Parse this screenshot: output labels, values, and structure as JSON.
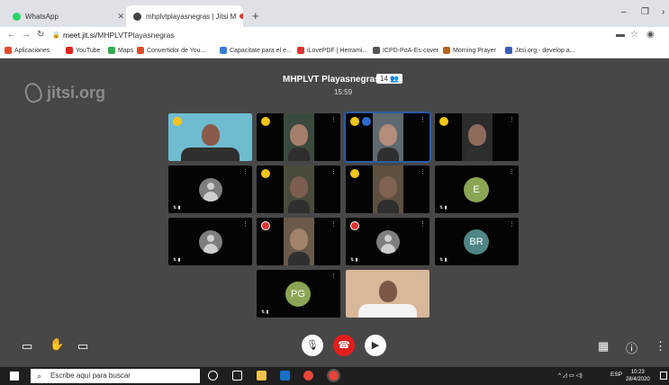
{
  "browser": {
    "tabs": [
      {
        "label": "WhatsApp",
        "color": "#25d366"
      },
      {
        "label": "mhplvtplayasnegras | Jitsi M",
        "color": "#444444"
      }
    ],
    "new_tab": "+",
    "url_prefix": "meet.jit.si/",
    "url_path": "MHPLVTPlayasnegras",
    "bookmarks": [
      {
        "label": "Aplicaciones",
        "color": "#e04c2d"
      },
      {
        "label": "YouTube",
        "color": "#e62117"
      },
      {
        "label": "Maps",
        "color": "#34a853"
      },
      {
        "label": "Convertidor de You...",
        "color": "#e04c2d"
      },
      {
        "label": "Capacítate para el e...",
        "color": "#3a7bd5"
      },
      {
        "label": "iLovePDF | Herrami...",
        "color": "#d33"
      },
      {
        "label": "ICPD-PoA-Es-cover",
        "color": "#555555"
      },
      {
        "label": "Morning Prayer",
        "color": "#b5651d"
      },
      {
        "label": "Jitsi.org - develop a...",
        "color": "#3a5bb8"
      }
    ]
  },
  "meeting": {
    "logo": "jitsi.org",
    "title": "MHPLVT Playasnegras",
    "participant_count": "14",
    "timer": "15:59"
  },
  "tiles": [
    {
      "kind": "video",
      "dot": "yellow",
      "bg": "#6fbcd0",
      "fg": "#8a5a4a"
    },
    {
      "kind": "video",
      "dot": "yellow",
      "bg": "#3b4a3f",
      "fg": "#a77e6c"
    },
    {
      "kind": "video",
      "dot": "yellow",
      "bg": "#5f6a70",
      "fg": "#b48d7a",
      "active": true
    },
    {
      "kind": "video",
      "dot": "yellow",
      "bg": "#2c2c2c",
      "fg": "#8d6b5a"
    },
    {
      "kind": "avatar",
      "dot": "none"
    },
    {
      "kind": "video",
      "dot": "yellow",
      "bg": "#4a4a3a",
      "fg": "#7b5e50"
    },
    {
      "kind": "video",
      "dot": "yellow",
      "bg": "#5e5040",
      "fg": "#806252"
    },
    {
      "kind": "initials",
      "label": "E",
      "color": "#8aa554"
    },
    {
      "kind": "avatar",
      "dot": "none"
    },
    {
      "kind": "video",
      "dot": "red",
      "bg": "#6b5a4a",
      "fg": "#a2836c"
    },
    {
      "kind": "avatar",
      "dot": "red"
    },
    {
      "kind": "initials",
      "label": "BR",
      "color": "#4f8585"
    },
    {
      "kind": "initials",
      "label": "PG",
      "color": "#8aa554"
    },
    {
      "kind": "video",
      "dot": "none",
      "bg": "#d8b79a",
      "fg": "#7d5745"
    }
  ],
  "taskbar": {
    "search_placeholder": "Escribe aquí para buscar",
    "language": "ESP",
    "time": "10:23",
    "date": "28/4/2020"
  }
}
